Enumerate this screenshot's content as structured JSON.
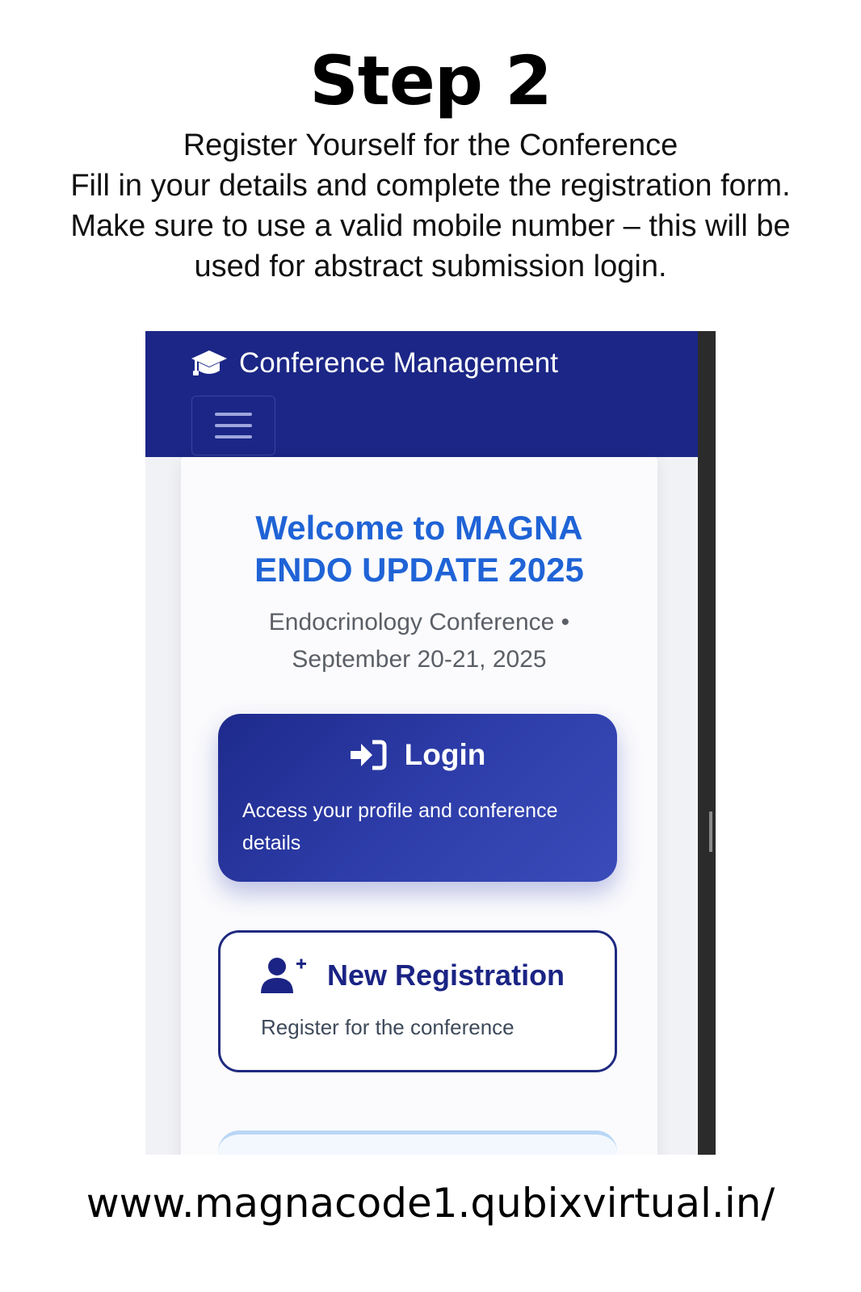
{
  "instructions": {
    "title": "Step 2",
    "lines": [
      "Register Yourself for the Conference",
      "Fill in your details and complete the registration form.",
      "Make sure to use a valid mobile number – this will be",
      "used for abstract submission login."
    ]
  },
  "app": {
    "brand_icon": "graduation-cap-icon",
    "brand": "Conference Management",
    "menu_icon": "hamburger-icon"
  },
  "welcome": {
    "title_line1": "Welcome to MAGNA",
    "title_line2": "ENDO UPDATE 2025",
    "subtitle_line1": "Endocrinology Conference •",
    "subtitle_line2": "September 20-21, 2025"
  },
  "login_card": {
    "icon": "sign-in-icon",
    "title": "Login",
    "description": "Access your profile and conference details"
  },
  "registration_card": {
    "icon": "user-plus-icon",
    "title": "New Registration",
    "description": "Register for the conference"
  },
  "footer": {
    "url": "www.magnacode1.qubixvirtual.in/"
  },
  "colors": {
    "navbar": "#1b2686",
    "welcome_text": "#1f63d6",
    "login_gradient_start": "#1e2a8c",
    "login_gradient_end": "#3a4cba",
    "registration_border": "#1f2a80"
  }
}
